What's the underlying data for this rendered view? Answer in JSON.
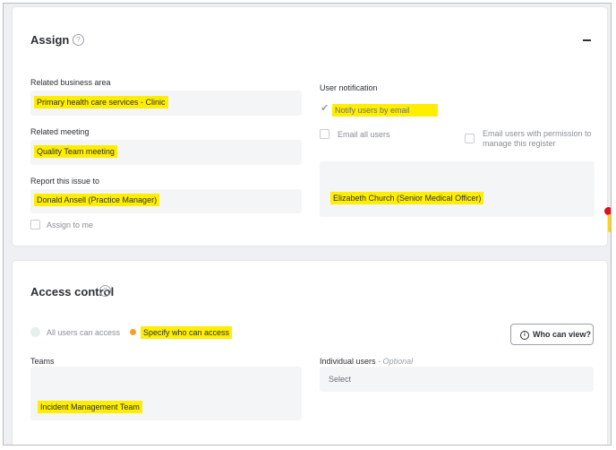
{
  "assign": {
    "title": "Assign",
    "help_glyph": "?",
    "related_business_area": {
      "label": "Related business area",
      "value": "Primary health care services - Clinic"
    },
    "related_meeting": {
      "label": "Related meeting",
      "value": "Quality Team meeting"
    },
    "report_to": {
      "label": "Report this issue to",
      "value": "Donald Ansell (Practice Manager)"
    },
    "assign_to_me": "Assign to me",
    "user_notification": {
      "label": "User notification",
      "notify_by_email": "Notify users by email",
      "email_all_users": "Email all users",
      "email_with_permission": "Email users with permission to manage this register",
      "recipient": "Elizabeth Church (Senior Medical Officer)"
    }
  },
  "access_control": {
    "title": "Access control",
    "help_glyph": "?",
    "all_users": "All users can access",
    "specify": "Specify who can access",
    "who_can_view": "Who can view?",
    "teams": {
      "label": "Teams",
      "value": "Incident Management Team"
    },
    "individual_users": {
      "label": "Individual users",
      "optional": "- Optional",
      "placeholder": "Select"
    }
  },
  "colors": {
    "highlight": "#ffee00",
    "accent_radio": "#f4a024",
    "scroll_marker": "#e0101a"
  },
  "icons": [
    "help-icon",
    "collapse-icon",
    "check-icon",
    "info-icon"
  ]
}
